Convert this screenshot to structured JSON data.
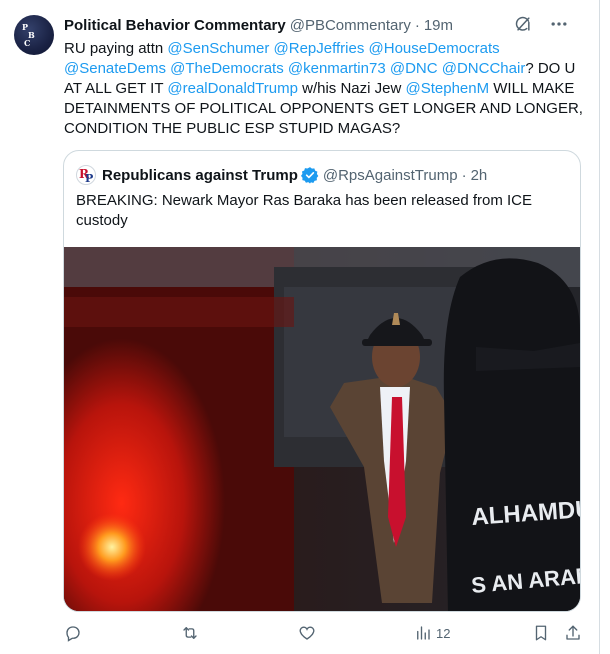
{
  "tweet": {
    "author_name": "Political Behavior Commentary",
    "author_handle": "@PBCommentary",
    "separator": "·",
    "time": "19m",
    "avatar_letters": [
      "P",
      "B",
      "C"
    ],
    "text_segments": [
      {
        "type": "text",
        "value": "RU paying attn "
      },
      {
        "type": "mention",
        "value": "@SenSchumer"
      },
      {
        "type": "text",
        "value": " "
      },
      {
        "type": "mention",
        "value": "@RepJeffries"
      },
      {
        "type": "text",
        "value": " "
      },
      {
        "type": "mention",
        "value": "@HouseDemocrats"
      },
      {
        "type": "text",
        "value": " "
      },
      {
        "type": "mention",
        "value": "@SenateDems"
      },
      {
        "type": "text",
        "value": " "
      },
      {
        "type": "mention",
        "value": "@TheDemocrats"
      },
      {
        "type": "text",
        "value": " "
      },
      {
        "type": "mention",
        "value": "@kenmartin73"
      },
      {
        "type": "text",
        "value": " "
      },
      {
        "type": "mention",
        "value": "@DNC"
      },
      {
        "type": "text",
        "value": " "
      },
      {
        "type": "mention",
        "value": "@DNCChair"
      },
      {
        "type": "text",
        "value": "? DO U AT ALL GET IT  "
      },
      {
        "type": "mention",
        "value": "@realDonaldTrump"
      },
      {
        "type": "text",
        "value": " w/his Nazi Jew "
      },
      {
        "type": "mention",
        "value": "@StephenM"
      },
      {
        "type": "text",
        "value": " WILL MAKE DETAINMENTS OF POLITICAL OPPONENTS GET LONGER AND LONGER, CONDITION THE PUBLIC ESP STUPID MAGAS?"
      }
    ]
  },
  "quote": {
    "author_name": "Republicans against Trump",
    "author_handle": "@RpsAgainstTrump",
    "separator": "·",
    "time": "2h",
    "avatar_letters": [
      "R",
      "P"
    ],
    "text": "BREAKING: Newark Mayor Ras Baraka has been released from ICE custody",
    "image_text": [
      "ALHAMDU",
      "S AN ARABI"
    ]
  },
  "actions": {
    "views_count": "12"
  },
  "colors": {
    "link": "#1d9bf0",
    "secondary_text": "#536471",
    "border": "#cfd9de",
    "verified": "#1d9bf0"
  },
  "icons": {
    "header": [
      "grok-icon",
      "more-icon"
    ],
    "actions": [
      "reply-icon",
      "retweet-icon",
      "like-icon",
      "views-icon",
      "bookmark-icon",
      "share-icon"
    ]
  }
}
